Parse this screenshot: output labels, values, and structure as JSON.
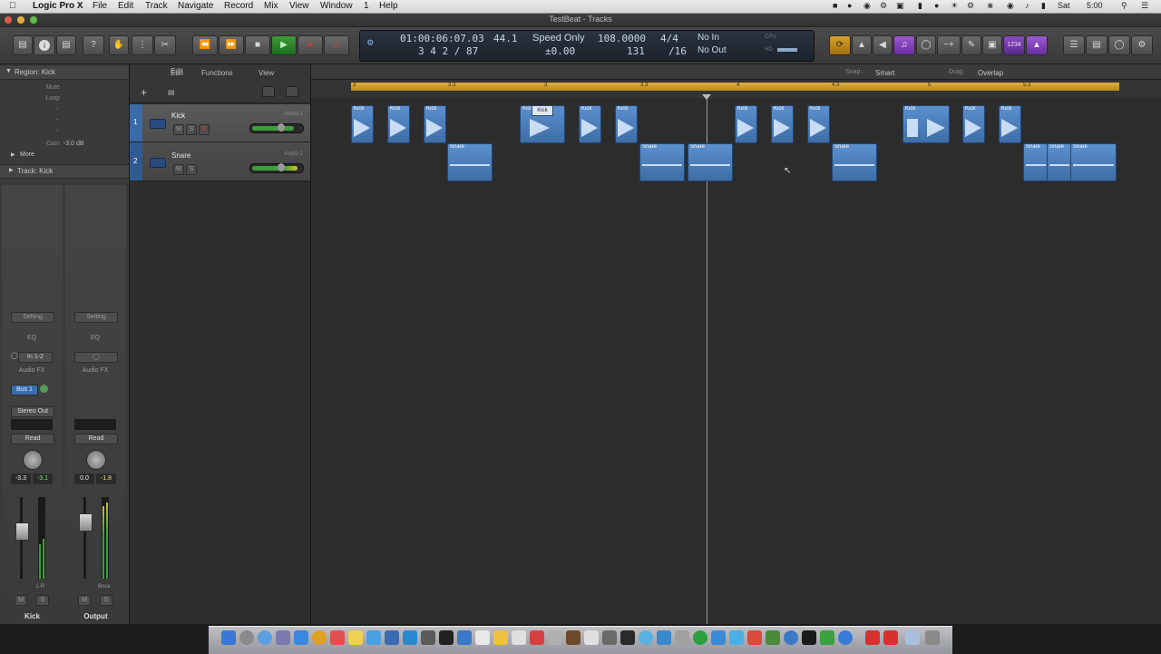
{
  "menubar": {
    "apple": "",
    "app_name": "Logic Pro X",
    "items": [
      "File",
      "Edit",
      "Track",
      "Navigate",
      "Record",
      "Mix",
      "View",
      "Window",
      "1",
      "Help"
    ],
    "status": {
      "battery": "",
      "clock": "5:00",
      "day": "Sat"
    }
  },
  "window": {
    "title": "TestBeat - Tracks"
  },
  "control_bar": {
    "lcd": {
      "time": "01:00:06:07.03",
      "bars": "3  4  2  /  87",
      "sample_rate": "44.1",
      "mode": "Speed Only",
      "pitch": "±0.00",
      "tempo": "108.0000",
      "tempo_sub": "131",
      "signature": "4/4",
      "division": "/16",
      "in": "No In",
      "out": "No Out",
      "cpu_label": "CPU",
      "hd_label": "HD"
    },
    "counter": "1234"
  },
  "inspector": {
    "region_header": "Region: Kick",
    "region_props": [
      {
        "label": "Mute",
        "value": ""
      },
      {
        "label": "Loop",
        "value": ""
      },
      {
        "label": "",
        "value": "-"
      },
      {
        "label": "",
        "value": "-"
      },
      {
        "label": "",
        "value": "-"
      },
      {
        "label": "Gain",
        "value": "-3.0 dB"
      }
    ],
    "more_label": "More",
    "track_header": "Track: Kick",
    "strip_left": {
      "setting": "Setting",
      "eq": "EQ",
      "input": "In 1-2",
      "audio_fx": "Audio FX",
      "send": "Bus 1",
      "output": "Stereo Out",
      "automation": "Read",
      "pan_values": [
        "-3.3",
        "-3.1"
      ],
      "name": "Kick",
      "ms": [
        "M",
        "S"
      ],
      "lr": "L R"
    },
    "strip_right": {
      "setting": "Setting",
      "eq": "EQ",
      "input": "",
      "audio_fx": "Audio FX",
      "automation": "Read",
      "pan_values": [
        "0.0",
        "-1.8"
      ],
      "bnce": "Bnce",
      "name": "Output",
      "ms": [
        "M",
        "S"
      ]
    }
  },
  "local_bar": {
    "edit": "Edit",
    "functions": "Functions",
    "view": "View",
    "snap_label": "Snap:",
    "snap_value": "Smart",
    "drag_label": "Drag:",
    "drag_value": "Overlap"
  },
  "ruler": {
    "marks": [
      "3",
      "3.3",
      "3",
      "3.3",
      "4",
      "4.3",
      "5",
      "5.3"
    ]
  },
  "tracks": [
    {
      "number": "1",
      "name": "Kick",
      "channel": "Audio 1",
      "mute": "M",
      "solo": "S",
      "record": "R",
      "selected": true
    },
    {
      "number": "2",
      "name": "Snare",
      "channel": "Audio 2",
      "mute": "M",
      "solo": "S",
      "record": "",
      "selected": false
    }
  ],
  "regions": {
    "kick": [
      {
        "name": "Kick",
        "start": 0.0,
        "width": 1
      },
      {
        "name": "Kick",
        "start": 1,
        "width": 1
      },
      {
        "name": "Kick",
        "start": 2,
        "width": 1
      },
      {
        "name": "Kick",
        "start": 5,
        "width": 1
      },
      {
        "name": "Kick",
        "start": 6,
        "width": 1
      },
      {
        "name": "Kick",
        "start": 7,
        "width": 1
      },
      {
        "name": "Kick",
        "start": 8,
        "width": 1
      },
      {
        "name": "Kick",
        "start": 11,
        "width": 1
      },
      {
        "name": "Kick",
        "start": 12,
        "width": 1
      },
      {
        "name": "Kick",
        "start": 13,
        "width": 1
      },
      {
        "name": "Kick",
        "start": 16,
        "width": 1
      },
      {
        "name": "Kick",
        "start": 17,
        "width": 1
      },
      {
        "name": "Kick",
        "start": 18,
        "width": 1
      },
      {
        "name": "Kick",
        "start": 19,
        "width": 1
      }
    ],
    "snare": [
      {
        "name": "Snare"
      },
      {
        "name": "Snare"
      },
      {
        "name": "Snare"
      },
      {
        "name": "Snare"
      },
      {
        "name": "Snare"
      },
      {
        "name": "Snare"
      },
      {
        "name": "Snare"
      }
    ],
    "tooltip": "Kick"
  },
  "colors": {
    "region": "#4f84c2",
    "ruler_cycle": "#d4a02a",
    "play": "#2a9a2a",
    "accent_blue": "#4c7fc0",
    "purple": "#8a4ac0"
  }
}
